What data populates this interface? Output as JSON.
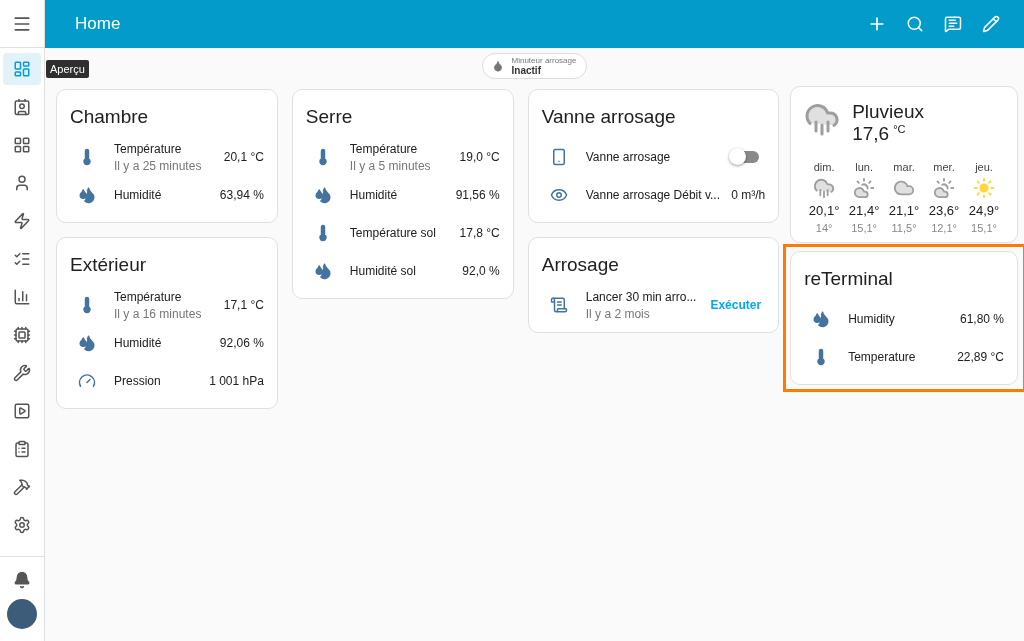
{
  "toolbar": {
    "title": "Home"
  },
  "sidebar": {
    "items": [
      {
        "kind": "overview",
        "selected": true,
        "tooltip": "Aperçu"
      },
      {
        "kind": "board",
        "selected": false
      },
      {
        "kind": "grid",
        "selected": false
      },
      {
        "kind": "person",
        "selected": false
      },
      {
        "kind": "energy",
        "selected": false
      },
      {
        "kind": "list",
        "selected": false
      },
      {
        "kind": "chart",
        "selected": false
      },
      {
        "kind": "chip",
        "selected": false
      },
      {
        "kind": "wrench",
        "selected": false
      },
      {
        "kind": "media",
        "selected": false
      },
      {
        "kind": "clipboard",
        "selected": false
      },
      {
        "kind": "hammer",
        "selected": false
      },
      {
        "kind": "settings",
        "selected": false
      }
    ]
  },
  "badge": {
    "label": "Minuteur arrosage",
    "state": "Inactif"
  },
  "columns": [
    [
      {
        "title": "Chambre",
        "highlighted": false,
        "entities": [
          {
            "kind": "temperature",
            "name": "Température",
            "secondary": "Il y a 25 minutes",
            "value": "20,1 °C"
          },
          {
            "kind": "humidity",
            "name": "Humidité",
            "value": "63,94 %"
          }
        ]
      },
      {
        "title": "Extérieur",
        "highlighted": false,
        "entities": [
          {
            "kind": "temperature",
            "name": "Température",
            "secondary": "Il y a 16 minutes",
            "value": "17,1 °C"
          },
          {
            "kind": "humidity",
            "name": "Humidité",
            "value": "92,06 %"
          },
          {
            "kind": "pressure",
            "name": "Pression",
            "value": "1 001 hPa"
          }
        ]
      }
    ],
    [
      {
        "title": "Serre",
        "highlighted": false,
        "entities": [
          {
            "kind": "temperature",
            "name": "Température",
            "secondary": "Il y a 5 minutes",
            "value": "19,0 °C"
          },
          {
            "kind": "humidity",
            "name": "Humidité",
            "value": "91,56 %"
          },
          {
            "kind": "temperature",
            "name": "Température sol",
            "value": "17,8 °C"
          },
          {
            "kind": "humidity",
            "name": "Humidité sol",
            "value": "92,0 %"
          }
        ]
      }
    ],
    [
      {
        "title": "Vanne arrosage",
        "highlighted": false,
        "entities": [
          {
            "kind": "switch",
            "name": "Vanne arrosage",
            "on": false
          },
          {
            "kind": "flow",
            "name": "Vanne arrosage Débit v...",
            "value": "0 m³/h"
          }
        ]
      },
      {
        "title": "Arrosage",
        "highlighted": false,
        "entities": [
          {
            "kind": "script",
            "name": "Lancer 30 min arro...",
            "secondary": "Il y a 2 mois",
            "action": "Exécuter"
          }
        ]
      }
    ],
    [
      {
        "kind": "weather",
        "condition": "Pluvieux",
        "temperature": "17,6",
        "unit": "°C",
        "forecast": [
          {
            "day": "dim.",
            "kind": "rainy",
            "high": "20,1°",
            "low": "14°"
          },
          {
            "day": "lun.",
            "kind": "partly",
            "high": "21,4°",
            "low": "15,1°"
          },
          {
            "day": "mar.",
            "kind": "cloudy",
            "high": "21,1°",
            "low": "11,5°"
          },
          {
            "day": "mer.",
            "kind": "partly",
            "high": "23,6°",
            "low": "12,1°"
          },
          {
            "day": "jeu.",
            "kind": "sunny",
            "high": "24,9°",
            "low": "15,1°"
          }
        ]
      },
      {
        "title": "reTerminal",
        "highlighted": true,
        "entities": [
          {
            "kind": "humidity",
            "name": "Humidity",
            "value": "61,80 %"
          },
          {
            "kind": "temperature",
            "name": "Temperature",
            "value": "22,89 °C"
          }
        ]
      }
    ]
  ]
}
